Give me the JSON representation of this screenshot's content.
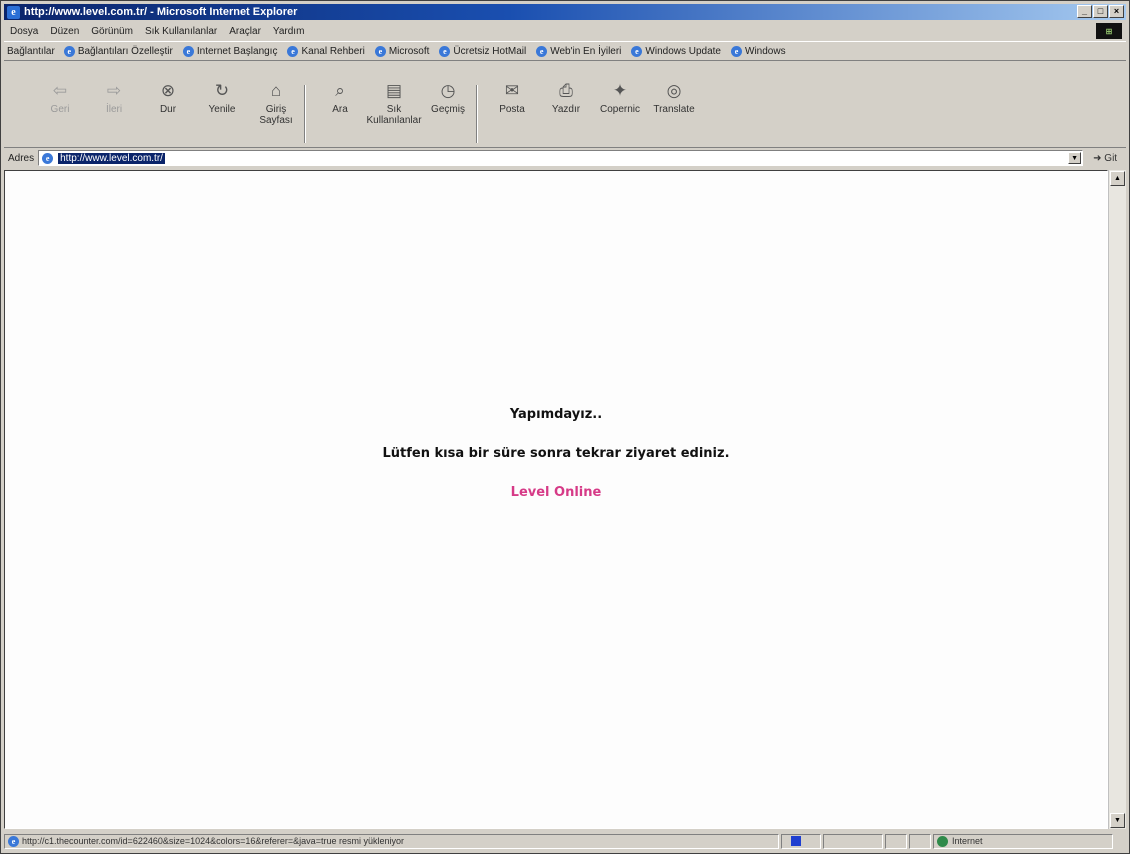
{
  "window": {
    "title": "http://www.level.com.tr/ - Microsoft Internet Explorer"
  },
  "menu": {
    "items": [
      "Dosya",
      "Düzen",
      "Görünüm",
      "Sık Kullanılanlar",
      "Araçlar",
      "Yardım"
    ]
  },
  "links_bar": {
    "label": "Bağlantılar",
    "items": [
      "Bağlantıları Özelleştir",
      "Internet Başlangıç",
      "Kanal Rehberi",
      "Microsoft",
      "Ücretsiz HotMail",
      "Web'in En İyileri",
      "Windows Update",
      "Windows"
    ]
  },
  "toolbar": {
    "back": "Geri",
    "forward": "İleri",
    "stop": "Dur",
    "refresh": "Yenile",
    "home": "Giriş Sayfası",
    "search": "Ara",
    "favorites": "Sık Kullanılanlar",
    "history": "Geçmiş",
    "mail": "Posta",
    "print": "Yazdır",
    "copernic": "Copernic",
    "translate": "Translate"
  },
  "address_bar": {
    "label": "Adres",
    "url": "http://www.level.com.tr/",
    "go": "Git"
  },
  "page": {
    "line1": "Yapımdayız..",
    "line2": "Lütfen kısa bir süre sonra tekrar ziyaret ediniz.",
    "line3": "Level Online",
    "line3_color": "#d63a87"
  },
  "status_bar": {
    "text": "http://c1.thecounter.com/id=622460&size=1024&colors=16&referer=&java=true resmi yükleniyor",
    "zone": "Internet"
  }
}
